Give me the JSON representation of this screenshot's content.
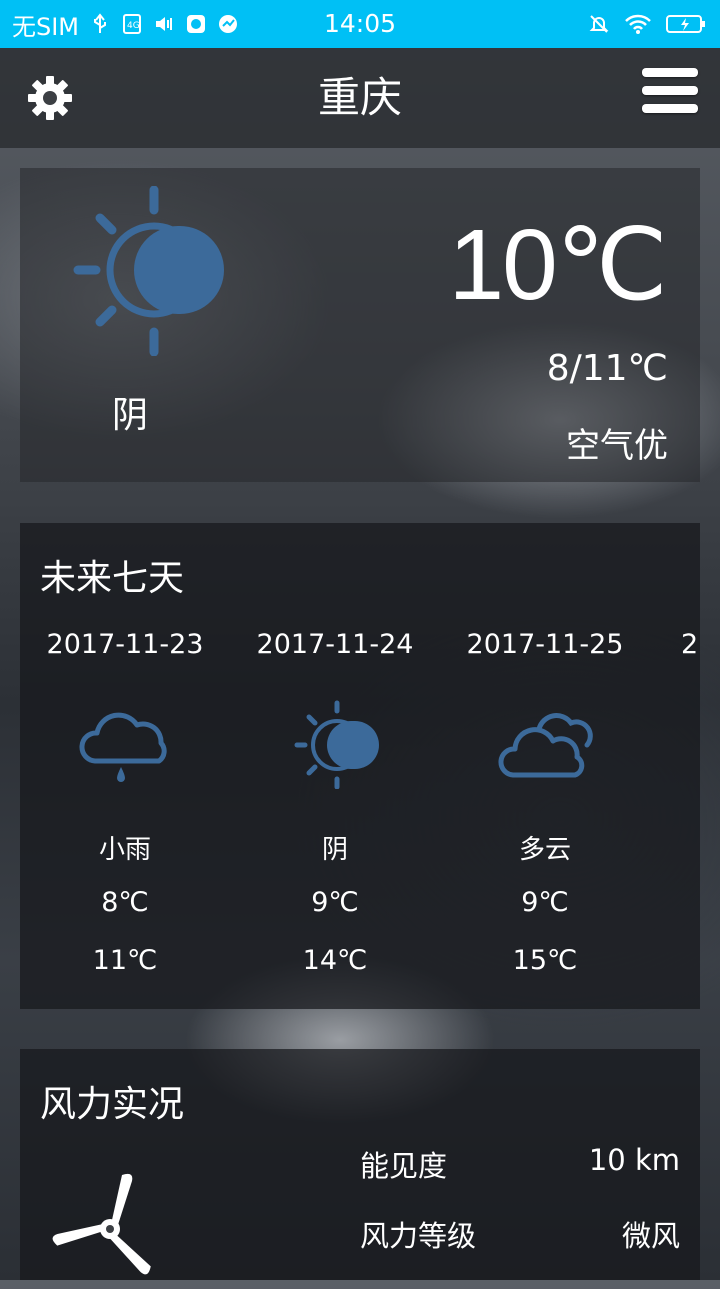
{
  "status_bar": {
    "carrier": "无SIM",
    "time": "14:05",
    "icons_left": [
      "usb-icon",
      "sim-icon",
      "volume-icon",
      "app-icon",
      "app-icon-2"
    ],
    "icons_right": [
      "bell-off-icon",
      "wifi-icon",
      "battery-charging-icon"
    ],
    "background": "#00c0f5"
  },
  "app_bar": {
    "title": "重庆",
    "left_icon": "gear-icon",
    "right_icon": "menu-icon"
  },
  "current": {
    "condition": "阴",
    "temperature": "10℃",
    "range": "8/11℃",
    "air_quality": "空气优",
    "icon": "cloudy-sun-icon",
    "icon_color": "#3c6a9a"
  },
  "forecast": {
    "title": "未来七天",
    "days": [
      {
        "date": "2017-11-23",
        "icon": "rain-cloud-icon",
        "desc": "小雨",
        "low": "8℃",
        "high": "11℃"
      },
      {
        "date": "2017-11-24",
        "icon": "cloudy-sun-icon",
        "desc": "阴",
        "low": "9℃",
        "high": "14℃"
      },
      {
        "date": "2017-11-25",
        "icon": "clouds-icon",
        "desc": "多云",
        "low": "9℃",
        "high": "15℃"
      },
      {
        "date": "2",
        "icon": "",
        "desc": "",
        "low": "",
        "high": ""
      }
    ]
  },
  "wind": {
    "title": "风力实况",
    "rows": [
      {
        "label": "能见度",
        "value": "10 km"
      },
      {
        "label": "风力等级",
        "value": "微风"
      }
    ],
    "icon": "fan-icon"
  }
}
